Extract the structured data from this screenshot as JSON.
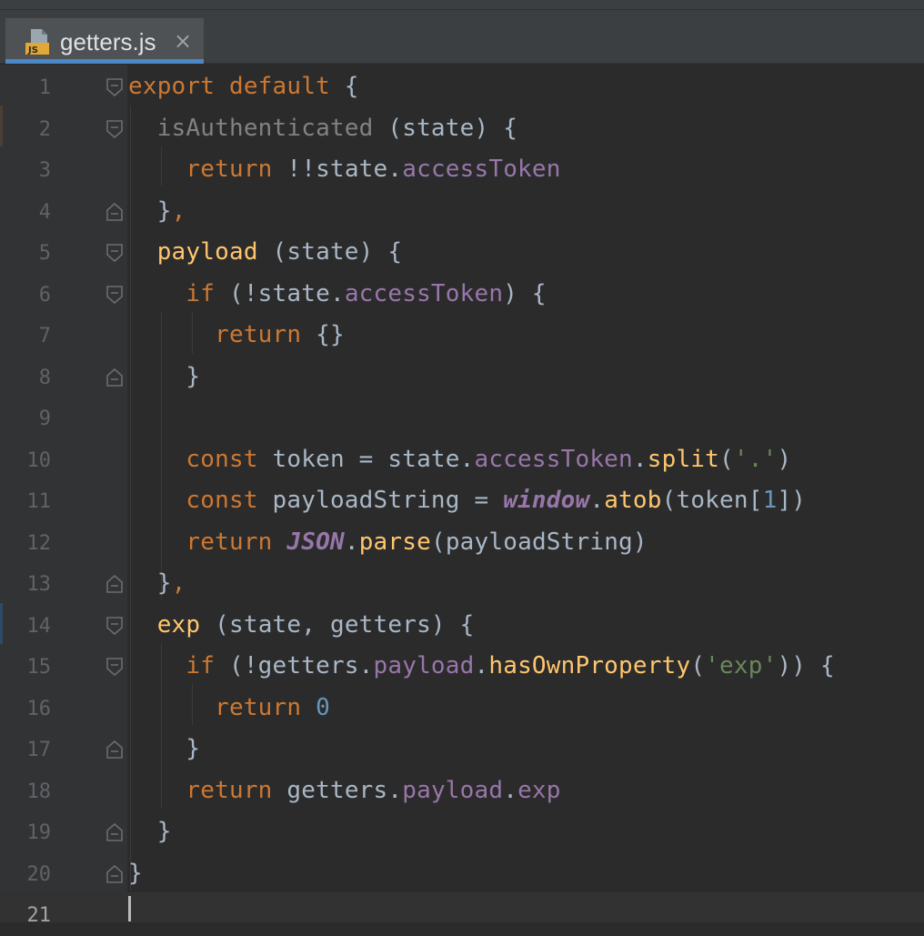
{
  "tab": {
    "label": "getters.js",
    "icon": "js-file-icon",
    "close_glyph": "×"
  },
  "colors": {
    "keyword": "#cc7832",
    "function": "#ffc66d",
    "property": "#9876aa",
    "plain": "#a9b7c6",
    "string": "#6a8759",
    "number": "#6897bb",
    "gutter_number": "#606366",
    "tab_accent": "#4a88c7"
  },
  "editor": {
    "current_line": 21,
    "lines": [
      {
        "num": "1",
        "tokens": [
          {
            "t": "export default",
            "c": "kw"
          },
          {
            "t": " {",
            "c": "plain"
          }
        ]
      },
      {
        "num": "2",
        "tokens": [
          {
            "t": "  isAuthenticated",
            "c": "dim"
          },
          {
            "t": " (state) {",
            "c": "plain"
          }
        ]
      },
      {
        "num": "3",
        "tokens": [
          {
            "t": "    return",
            "c": "kw"
          },
          {
            "t": " !!state.",
            "c": "plain"
          },
          {
            "t": "accessToken",
            "c": "prop"
          }
        ]
      },
      {
        "num": "4",
        "tokens": [
          {
            "t": "  }",
            "c": "plain"
          },
          {
            "t": ",",
            "c": "kw"
          }
        ]
      },
      {
        "num": "5",
        "tokens": [
          {
            "t": "  payload",
            "c": "fn"
          },
          {
            "t": " (state) {",
            "c": "plain"
          }
        ]
      },
      {
        "num": "6",
        "tokens": [
          {
            "t": "    if",
            "c": "kw"
          },
          {
            "t": " (!state.",
            "c": "plain"
          },
          {
            "t": "accessToken",
            "c": "prop"
          },
          {
            "t": ") {",
            "c": "plain"
          }
        ]
      },
      {
        "num": "7",
        "tokens": [
          {
            "t": "      return",
            "c": "kw"
          },
          {
            "t": " {}",
            "c": "plain"
          }
        ]
      },
      {
        "num": "8",
        "tokens": [
          {
            "t": "    }",
            "c": "plain"
          }
        ]
      },
      {
        "num": "9",
        "tokens": []
      },
      {
        "num": "10",
        "tokens": [
          {
            "t": "    const",
            "c": "kw"
          },
          {
            "t": " token = state.",
            "c": "plain"
          },
          {
            "t": "accessToken",
            "c": "prop"
          },
          {
            "t": ".",
            "c": "plain"
          },
          {
            "t": "split",
            "c": "fn"
          },
          {
            "t": "(",
            "c": "plain"
          },
          {
            "t": "'.'",
            "c": "str"
          },
          {
            "t": ")",
            "c": "plain"
          }
        ]
      },
      {
        "num": "11",
        "tokens": [
          {
            "t": "    const",
            "c": "kw"
          },
          {
            "t": " payloadString = ",
            "c": "plain"
          },
          {
            "t": "window",
            "c": "glob"
          },
          {
            "t": ".",
            "c": "plain"
          },
          {
            "t": "atob",
            "c": "fn"
          },
          {
            "t": "(token[",
            "c": "plain"
          },
          {
            "t": "1",
            "c": "num"
          },
          {
            "t": "])",
            "c": "plain"
          }
        ]
      },
      {
        "num": "12",
        "tokens": [
          {
            "t": "    return",
            "c": "kw"
          },
          {
            "t": " ",
            "c": "plain"
          },
          {
            "t": "JSON",
            "c": "glob"
          },
          {
            "t": ".",
            "c": "plain"
          },
          {
            "t": "parse",
            "c": "fn"
          },
          {
            "t": "(payloadString)",
            "c": "plain"
          }
        ]
      },
      {
        "num": "13",
        "tokens": [
          {
            "t": "  }",
            "c": "plain"
          },
          {
            "t": ",",
            "c": "kw"
          }
        ]
      },
      {
        "num": "14",
        "tokens": [
          {
            "t": "  exp",
            "c": "fn"
          },
          {
            "t": " (state, getters) {",
            "c": "plain"
          }
        ]
      },
      {
        "num": "15",
        "tokens": [
          {
            "t": "    if",
            "c": "kw"
          },
          {
            "t": " (!getters.",
            "c": "plain"
          },
          {
            "t": "payload",
            "c": "prop"
          },
          {
            "t": ".",
            "c": "plain"
          },
          {
            "t": "hasOwnProperty",
            "c": "fn"
          },
          {
            "t": "(",
            "c": "plain"
          },
          {
            "t": "'exp'",
            "c": "str"
          },
          {
            "t": ")) {",
            "c": "plain"
          }
        ]
      },
      {
        "num": "16",
        "tokens": [
          {
            "t": "      return",
            "c": "kw"
          },
          {
            "t": " ",
            "c": "plain"
          },
          {
            "t": "0",
            "c": "num"
          }
        ]
      },
      {
        "num": "17",
        "tokens": [
          {
            "t": "    }",
            "c": "plain"
          }
        ]
      },
      {
        "num": "18",
        "tokens": [
          {
            "t": "    return",
            "c": "kw"
          },
          {
            "t": " getters.",
            "c": "plain"
          },
          {
            "t": "payload",
            "c": "prop"
          },
          {
            "t": ".",
            "c": "plain"
          },
          {
            "t": "exp",
            "c": "prop"
          }
        ]
      },
      {
        "num": "19",
        "tokens": [
          {
            "t": "  }",
            "c": "plain"
          }
        ]
      },
      {
        "num": "20",
        "tokens": [
          {
            "t": "}",
            "c": "plain"
          }
        ]
      },
      {
        "num": "21",
        "tokens": []
      }
    ]
  }
}
